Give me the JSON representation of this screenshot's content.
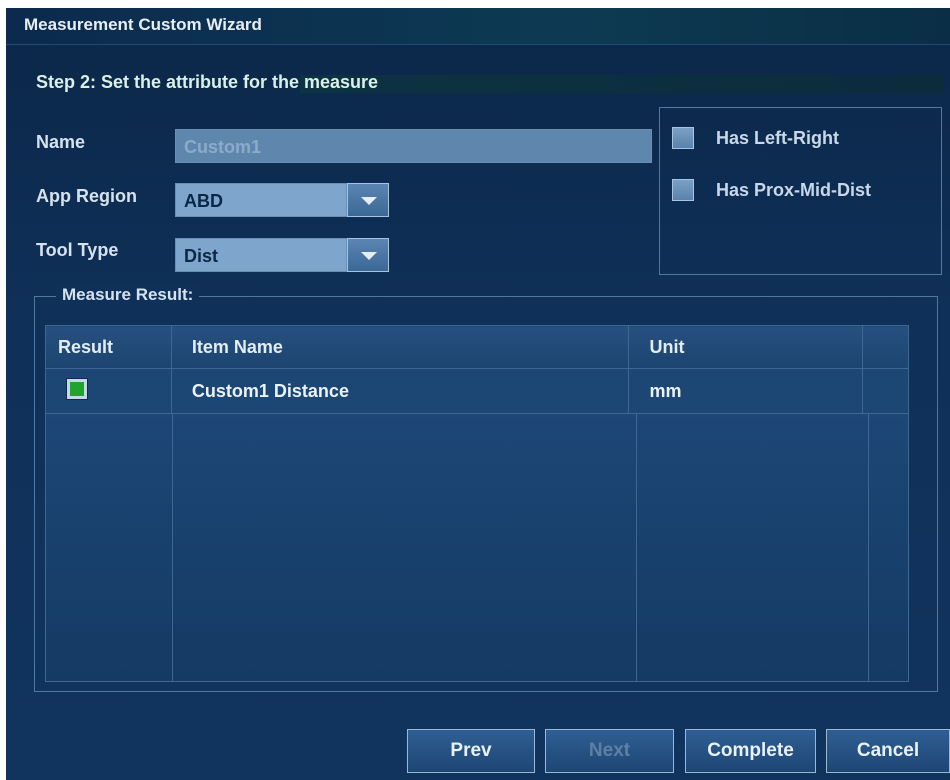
{
  "window": {
    "title": "Measurement Custom Wizard"
  },
  "step": {
    "text": "Step 2: Set the attribute for the measure"
  },
  "form": {
    "name_label": "Name",
    "name_value": "Custom1",
    "app_region_label": "App Region",
    "app_region_value": "ABD",
    "tool_type_label": "Tool Type",
    "tool_type_value": "Dist"
  },
  "options": {
    "has_left_right": "Has Left-Right",
    "has_prox_mid_dist": "Has Prox-Mid-Dist"
  },
  "measure_result": {
    "legend": "Measure Result:",
    "columns": [
      "Result",
      "Item Name",
      "Unit"
    ],
    "rows": [
      {
        "checked": true,
        "item_name": "Custom1 Distance",
        "unit": "mm"
      }
    ]
  },
  "buttons": {
    "prev": "Prev",
    "next": "Next",
    "complete": "Complete",
    "cancel": "Cancel"
  },
  "colors": {
    "checkbox_checked": "#1fa52e",
    "background": "#0f3058"
  }
}
